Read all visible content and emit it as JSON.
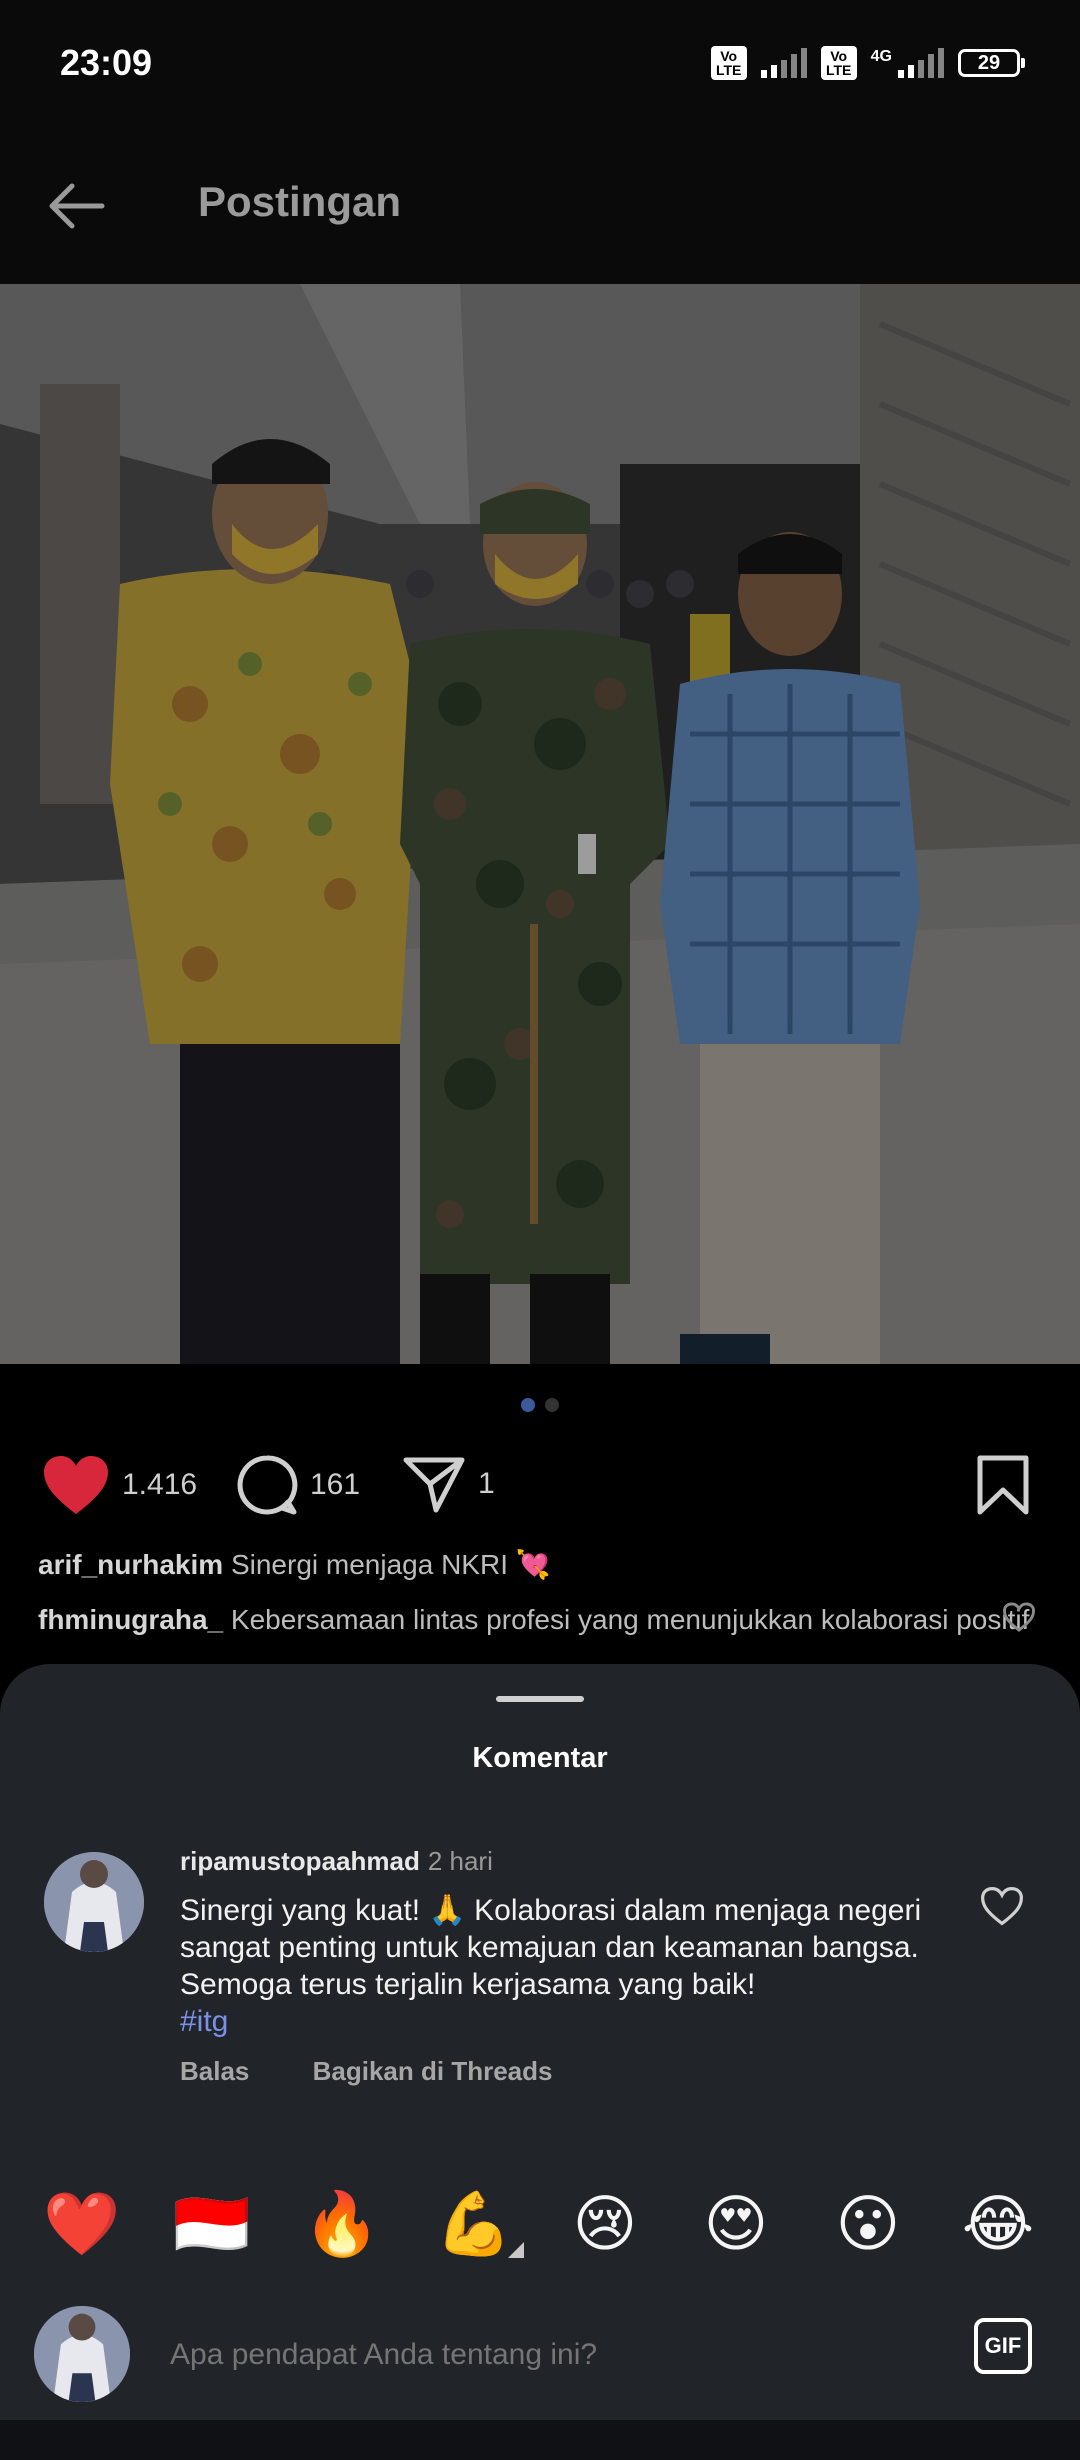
{
  "status_bar": {
    "time": "23:09",
    "battery": "29",
    "volte_1": "Vo LTE",
    "volte_2": "Vo LTE",
    "network": "4G"
  },
  "header": {
    "title": "Postingan",
    "back_icon": "arrow-left-icon"
  },
  "post": {
    "carousel_pages": 2,
    "carousel_active": 1,
    "likes": "1.416",
    "comments": "161",
    "shares": "1",
    "caption": {
      "user": "arif_nurhakim",
      "text": "Sinergi menjaga NKRI 💘"
    },
    "preview_comment": {
      "user": "fhminugraha_",
      "text": "Kebersamaan lintas profesi yang menunjukkan kolaborasi positif"
    }
  },
  "sheet": {
    "title": "Komentar",
    "comment": {
      "user": "ripamustopaahmad",
      "time": "2 hari",
      "text": "Sinergi yang kuat! 🙏 Kolaborasi dalam menjaga negeri sangat penting untuk kemajuan dan keamanan bangsa. Semoga terus terjalin kerjasama yang baik!",
      "hashtag": "#itg",
      "reply_label": "Balas",
      "share_label": "Bagikan di Threads"
    },
    "emojis": [
      "❤️",
      "🇮🇩",
      "🔥",
      "💪",
      "😢",
      "😍",
      "😮",
      "😂"
    ],
    "input_placeholder": "Apa pendapat Anda tentang ini?",
    "gif_label": "GIF"
  },
  "colors": {
    "like_red": "#d8263a",
    "background": "#000000",
    "sheet": "#212428",
    "link": "#7b90e8"
  }
}
